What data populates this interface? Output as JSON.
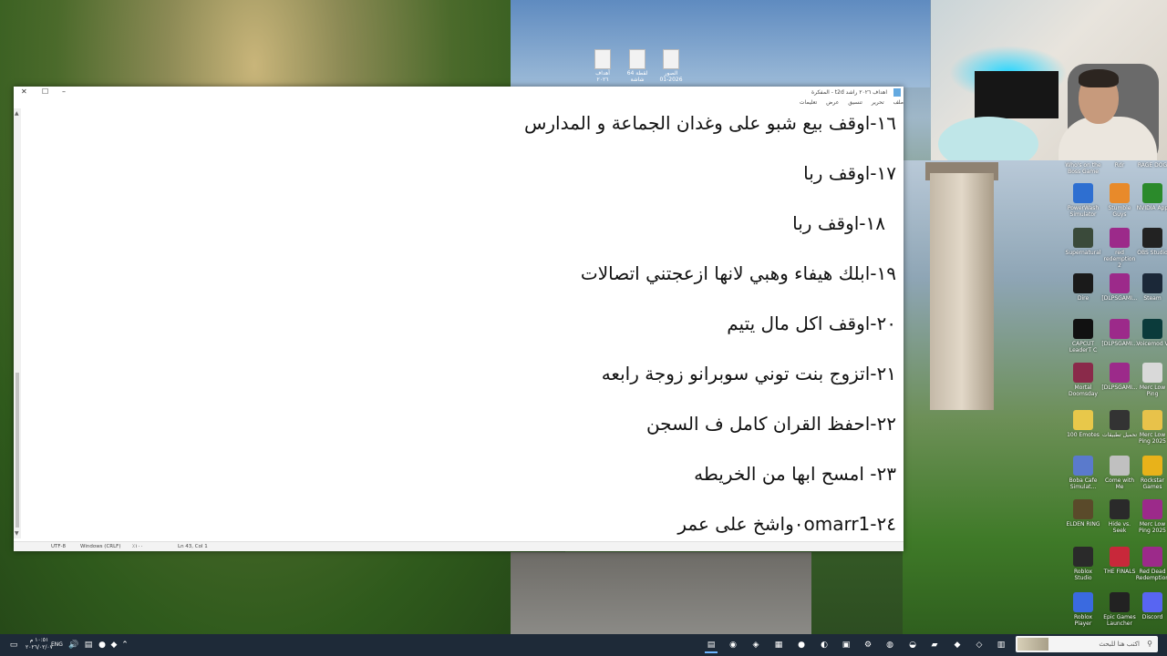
{
  "desktop": {
    "files": [
      "أهداف ٢٠٢٦",
      "64 لقطة شاشة",
      "الصور 2026-01"
    ]
  },
  "notepad": {
    "title": "اهداف ٢٠٢٦ راشد t2d - المفكرة",
    "menu": [
      "ملف",
      "تحرير",
      "تنسيق",
      "عرض",
      "تعليمات"
    ],
    "lines": [
      "١٦-اوقف بيع شبو على وغدان الجماعة و المدارس",
      "١٧-اوقف ربا",
      "١٨-اوقف ربا",
      "١٩-ابلك هيفاء وهبي لانها ازعجتني اتصالات",
      "٢٠-اوقف اكل مال يتيم",
      "٢١-اتزوج بنت توني سوبرانو زوجة رابعه",
      "٢٢-احفظ القران كامل ف السجن",
      "٢٣- امسح ابها من الخريطه",
      "٢٤-٠omarr1واشخ على عمر"
    ],
    "status": {
      "encoding": "UTF-8",
      "line_ending": "Windows (CRLF)",
      "zoom": "٪١٠٠",
      "position": "Ln 43, Col 1"
    }
  },
  "desktop_icons": [
    {
      "label": "Who's on the Boss Game",
      "icon": "game-icon",
      "color": "#4a4a6a"
    },
    {
      "label": "Rdr",
      "icon": "app-icon",
      "color": "#6a5a4a"
    },
    {
      "label": "RAGE DOG",
      "icon": "game-icon",
      "color": "#5a3a3a"
    },
    {
      "label": "PowerWash Simulator",
      "icon": "powerwash-icon",
      "color": "#2e6fd1"
    },
    {
      "label": "Stumble Guys",
      "icon": "stumble-icon",
      "color": "#e88a2a"
    },
    {
      "label": "NVIDIA App",
      "icon": "nvidia-icon",
      "color": "#2b8a2b"
    },
    {
      "label": "Supernatural",
      "icon": "supernatural-icon",
      "color": "#3a4a3a"
    },
    {
      "label": "red redemption 2",
      "icon": "archive-icon",
      "color": "#9c2a8a"
    },
    {
      "label": "OBS Studio",
      "icon": "obs-icon",
      "color": "#222222"
    },
    {
      "label": "Dire",
      "icon": "dire-icon",
      "color": "#1a1a1a"
    },
    {
      "label": "[DLPSGAMI...",
      "icon": "archive-icon",
      "color": "#9c2a8a"
    },
    {
      "label": "Steam",
      "icon": "steam-icon",
      "color": "#1b2838"
    },
    {
      "label": "CAPCUT LeaderT C",
      "icon": "capcut-icon",
      "color": "#111111"
    },
    {
      "label": "[DLPSGAMI...",
      "icon": "archive-icon",
      "color": "#9c2a8a"
    },
    {
      "label": "Voicemod V",
      "icon": "voicemod-icon",
      "color": "#0b3b3b"
    },
    {
      "label": "Mortal Doomsday",
      "icon": "game-icon",
      "color": "#8a2a4a"
    },
    {
      "label": "[DLPSGAMI...",
      "icon": "archive-icon",
      "color": "#9c2a8a"
    },
    {
      "label": "Merc Low Ping",
      "icon": "file-icon",
      "color": "#d9d9d9"
    },
    {
      "label": "100 Emotes",
      "icon": "emote-icon",
      "color": "#e8c84a"
    },
    {
      "label": "تحميل تطبيقات",
      "icon": "app-icon",
      "color": "#333333"
    },
    {
      "label": "Merc Low Ping 2025",
      "icon": "folder-icon",
      "color": "#e8c24a"
    },
    {
      "label": "Boba Cafe Simulat...",
      "icon": "game-icon",
      "color": "#5a7acc"
    },
    {
      "label": "Come with Me",
      "icon": "game-icon",
      "color": "#c0c0c0"
    },
    {
      "label": "Rockstar Games",
      "icon": "rockstar-icon",
      "color": "#e8b21a"
    },
    {
      "label": "ELDEN RING",
      "icon": "eldenring-icon",
      "color": "#5a4a2a"
    },
    {
      "label": "Hide vs. Seek",
      "icon": "game-icon",
      "color": "#2a2a2a"
    },
    {
      "label": "Merc Low Ping 2025",
      "icon": "archive-icon",
      "color": "#9c2a8a"
    },
    {
      "label": "Roblox Studio",
      "icon": "roblox-icon",
      "color": "#2a2a2a"
    },
    {
      "label": "THE FINALS",
      "icon": "thefinals-icon",
      "color": "#c8283a"
    },
    {
      "label": "Red Dead Redemption",
      "icon": "archive-icon",
      "color": "#9c2a8a"
    },
    {
      "label": "Roblox Player",
      "icon": "roblox-icon",
      "color": "#3a6ae0"
    },
    {
      "label": "Epic Games Launcher",
      "icon": "epic-icon",
      "color": "#222222"
    },
    {
      "label": "Discord",
      "icon": "discord-icon",
      "color": "#5865f2"
    }
  ],
  "taskbar": {
    "time": "١٠:٥١ م",
    "date": "٢٠٢٦/٠٢/٠٧",
    "language": "ENG",
    "search_placeholder": "اكتب هنا للبحث"
  }
}
